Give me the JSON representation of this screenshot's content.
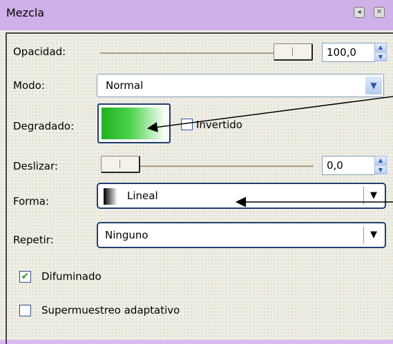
{
  "window": {
    "title": "Mezcla",
    "restore_glyph": "◂",
    "close_glyph": "✕"
  },
  "opacity": {
    "label": "Opacidad:",
    "value": "100,0",
    "level_percent": 100
  },
  "mode": {
    "label": "Modo:",
    "value": "Normal"
  },
  "gradient": {
    "label": "Degradado:",
    "invert_label": "Invertido",
    "invert_checked": false
  },
  "offset": {
    "label": "Deslizar:",
    "value": "0,0",
    "level_percent": 0
  },
  "shape": {
    "label": "Forma:",
    "value": "Lineal"
  },
  "repeat": {
    "label": "Repetir:",
    "value": "Ninguno"
  },
  "dither": {
    "label": "Difuminado",
    "checked": true
  },
  "supersample": {
    "label": "Supermuestreo adaptativo",
    "checked": false
  },
  "colors": {
    "accent": "#1f3c70",
    "gradient_start": "#1db21d",
    "gradient_end": "#ffffff"
  },
  "icons": [
    "restore-icon",
    "close-icon",
    "spin-up-icon",
    "spin-down-icon",
    "dropdown-arrow-icon",
    "checkmark-icon",
    "gradient-swatch",
    "shape-preview-icon",
    "callout-arrow"
  ]
}
